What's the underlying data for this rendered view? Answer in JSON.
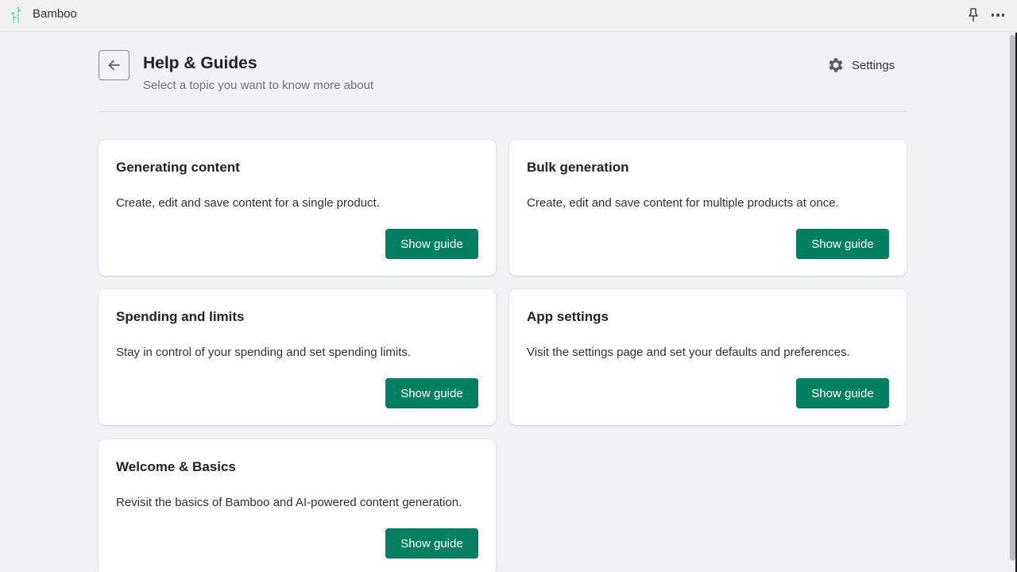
{
  "app": {
    "name": "Bamboo",
    "logo_icon": "bamboo-logo-icon",
    "logo_color": "#3fd9b4",
    "actions": [
      {
        "name": "pin",
        "icon": "pin-icon"
      },
      {
        "name": "more",
        "icon": "more-horizontal-icon"
      }
    ]
  },
  "header": {
    "back_icon": "arrow-left-icon",
    "title": "Help & Guides",
    "subtitle": "Select a topic you want to know more about",
    "settings": {
      "label": "Settings",
      "icon": "gear-icon"
    }
  },
  "colors": {
    "primary_button": "#008060",
    "background": "#f1f2f4",
    "card": "#ffffff"
  },
  "guides": [
    {
      "title": "Generating content",
      "description": "Create, edit and save content for a single product.",
      "button_label": "Show guide"
    },
    {
      "title": "Bulk generation",
      "description": "Create, edit and save content for multiple products at once.",
      "button_label": "Show guide"
    },
    {
      "title": "Spending and limits",
      "description": "Stay in control of your spending and set spending limits.",
      "button_label": "Show guide"
    },
    {
      "title": "App settings",
      "description": "Visit the settings page and set your defaults and preferences.",
      "button_label": "Show guide"
    },
    {
      "title": "Welcome & Basics",
      "description": "Revisit the basics of Bamboo and AI-powered content generation.",
      "button_label": "Show guide"
    }
  ]
}
